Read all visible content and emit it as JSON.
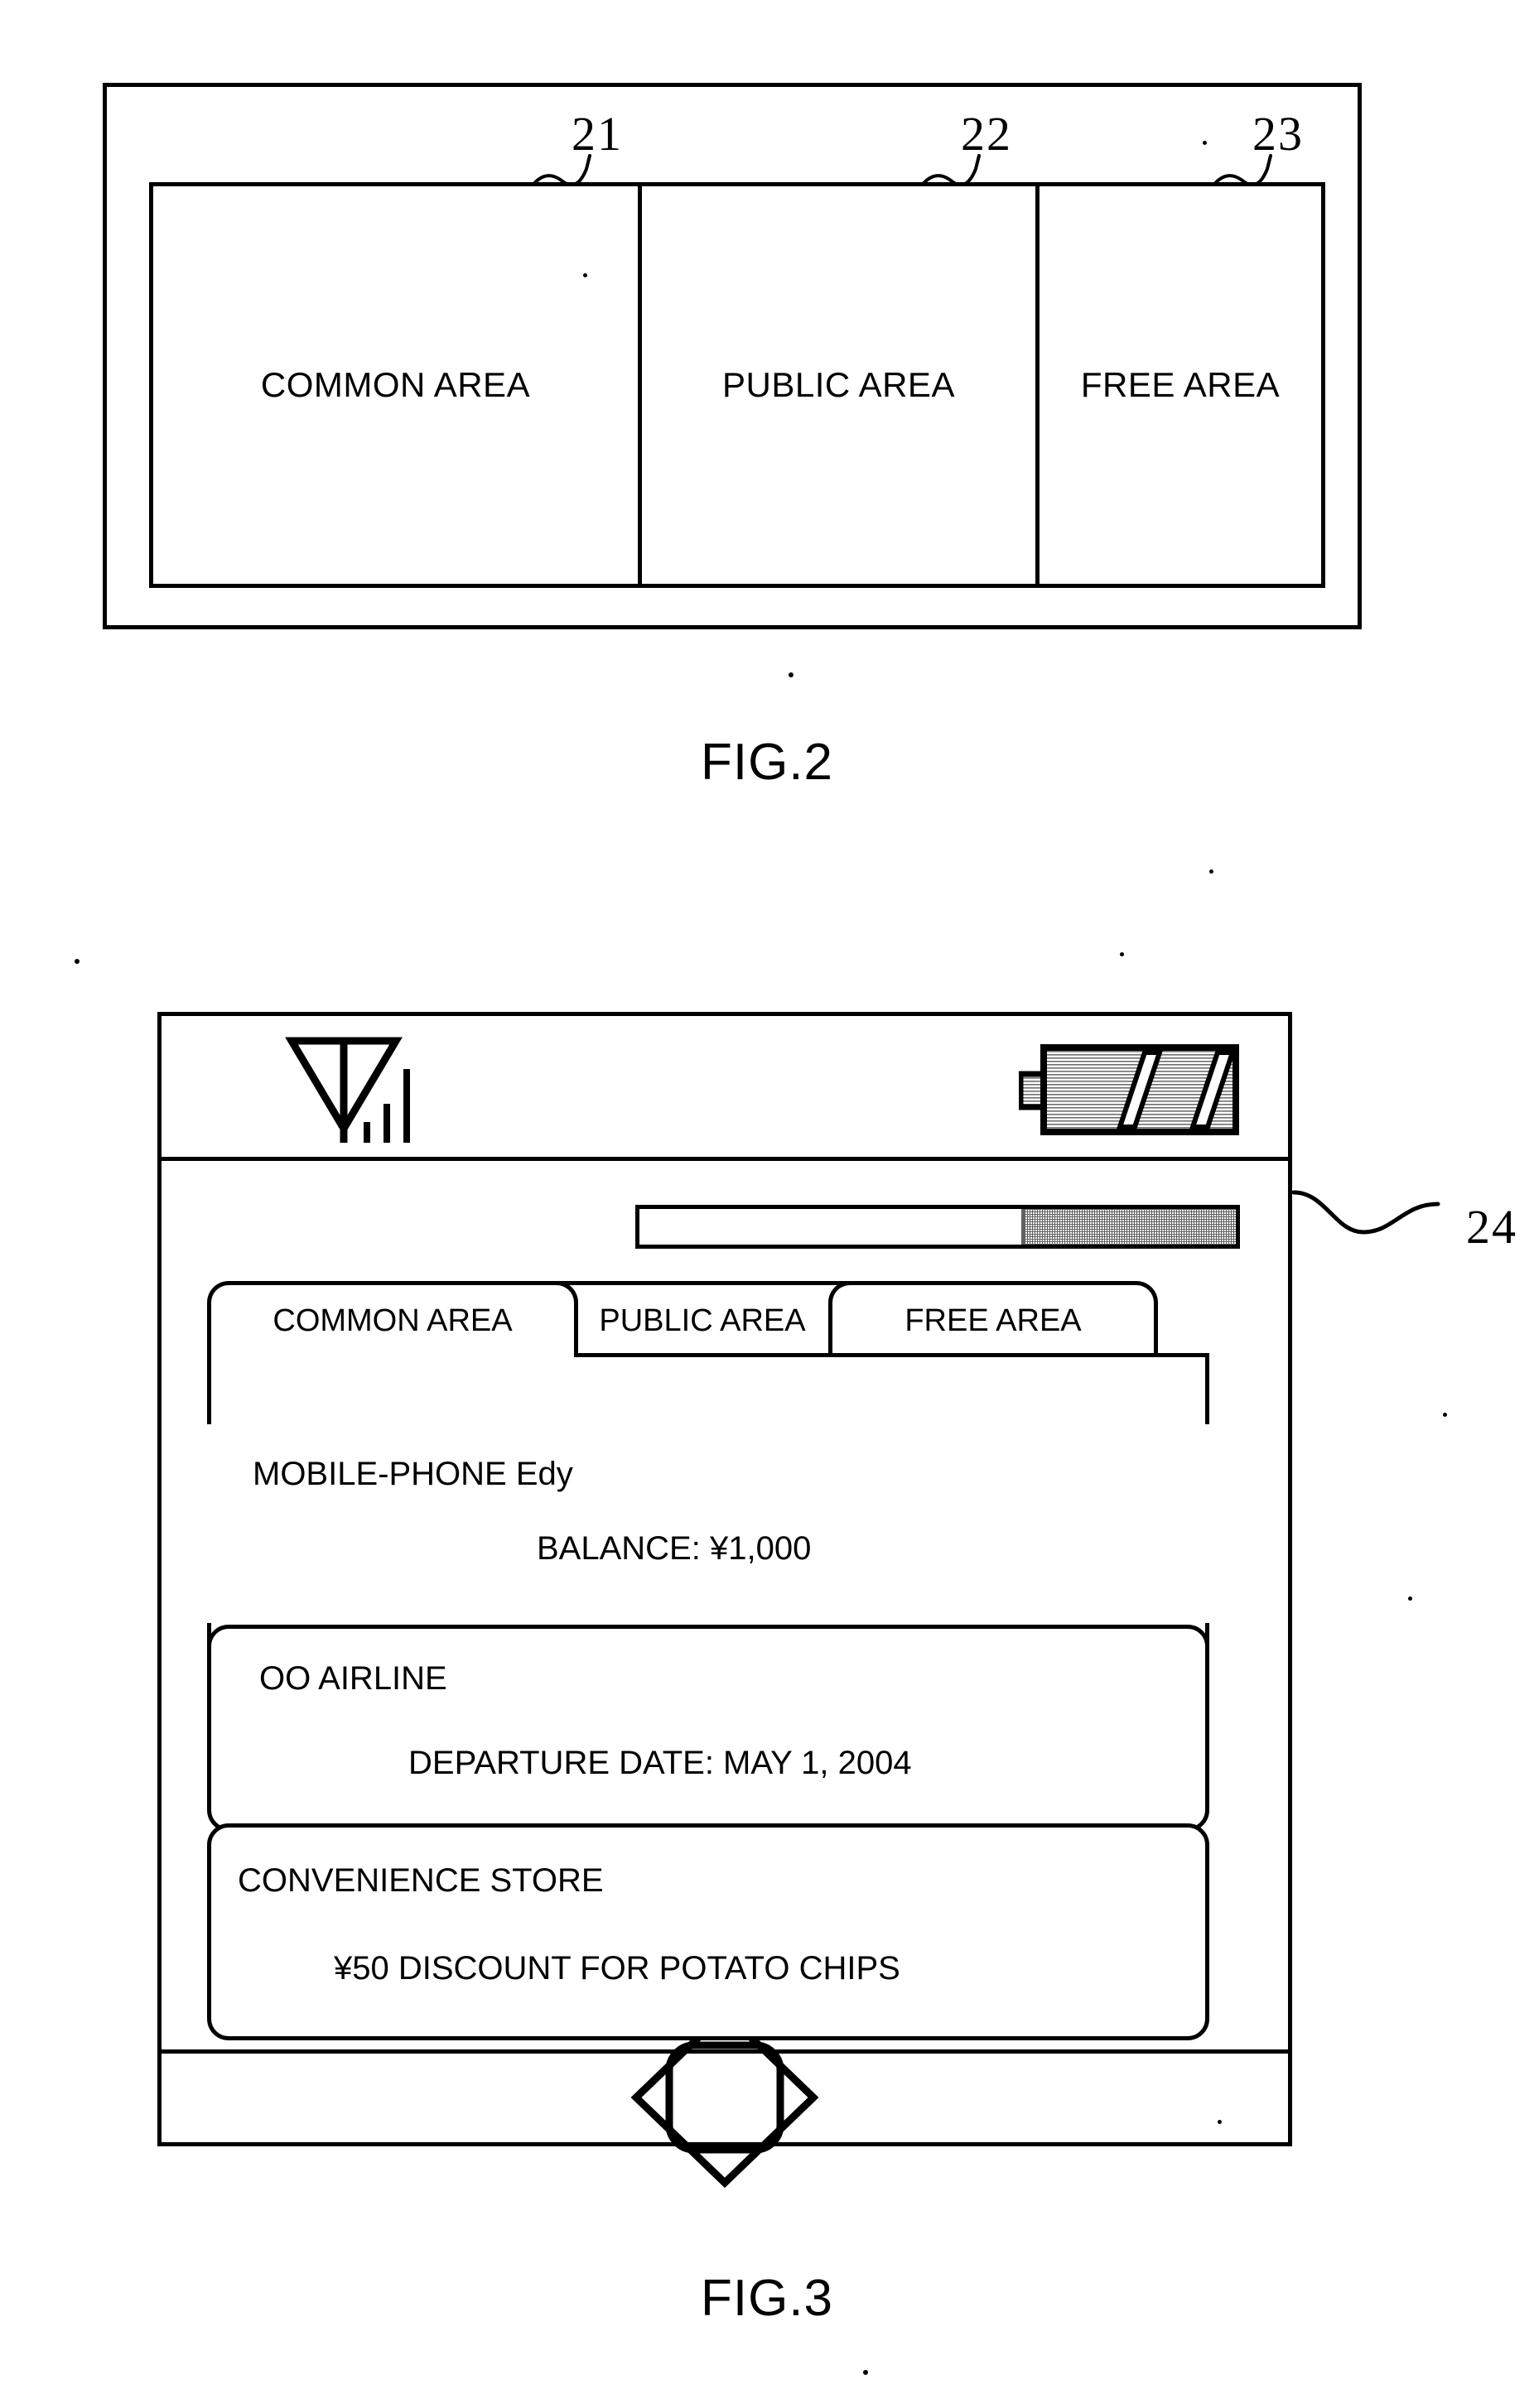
{
  "figures": [
    {
      "id": "fig2",
      "caption": "FIG.2",
      "areas": [
        {
          "label": "COMMON AREA",
          "ref": "21"
        },
        {
          "label": "PUBLIC AREA",
          "ref": "22"
        },
        {
          "label": "FREE AREA",
          "ref": "23"
        }
      ]
    },
    {
      "id": "fig3",
      "caption": "FIG.3",
      "status_bar": {
        "signal_icon": "antenna-signal-icon",
        "signal_bars": 3,
        "battery_icon": "battery-icon"
      },
      "progress_bar": {
        "ref": "24",
        "fill_percent": 36,
        "empty_percent": 64
      },
      "tabs": [
        {
          "label": "COMMON AREA",
          "active": true
        },
        {
          "label": "PUBLIC AREA",
          "active": false
        },
        {
          "label": "FREE AREA",
          "active": false
        }
      ],
      "cards": [
        {
          "title": "MOBILE-PHONE Edy",
          "detail": "BALANCE: ¥1,000"
        },
        {
          "title": "OO AIRLINE",
          "detail": "DEPARTURE DATE: MAY 1, 2004"
        },
        {
          "title": "CONVENIENCE STORE",
          "detail": "¥50 DISCOUNT FOR POTATO CHIPS"
        }
      ],
      "nav_pad": {
        "icon": "diamond-navigation-pad-icon"
      }
    }
  ],
  "colors": {
    "ink": "#000000",
    "paper": "#ffffff",
    "hatch_gray": "#9a9a9a"
  }
}
